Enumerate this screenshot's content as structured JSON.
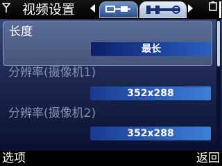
{
  "header": {
    "title": "视频设置",
    "icons": {
      "signal": "signal-icon",
      "tab1": "settings-connector-icon",
      "tab2": "settings-tools-icon",
      "battery": "battery-icon"
    }
  },
  "settings": [
    {
      "label": "长度",
      "value": "最长"
    },
    {
      "label": "分辨率(摄像机1)",
      "value": "352x288"
    },
    {
      "label": "分辨率(摄像机2)",
      "value": "352x288"
    }
  ],
  "softkeys": {
    "left": "选项",
    "right": "返回"
  }
}
